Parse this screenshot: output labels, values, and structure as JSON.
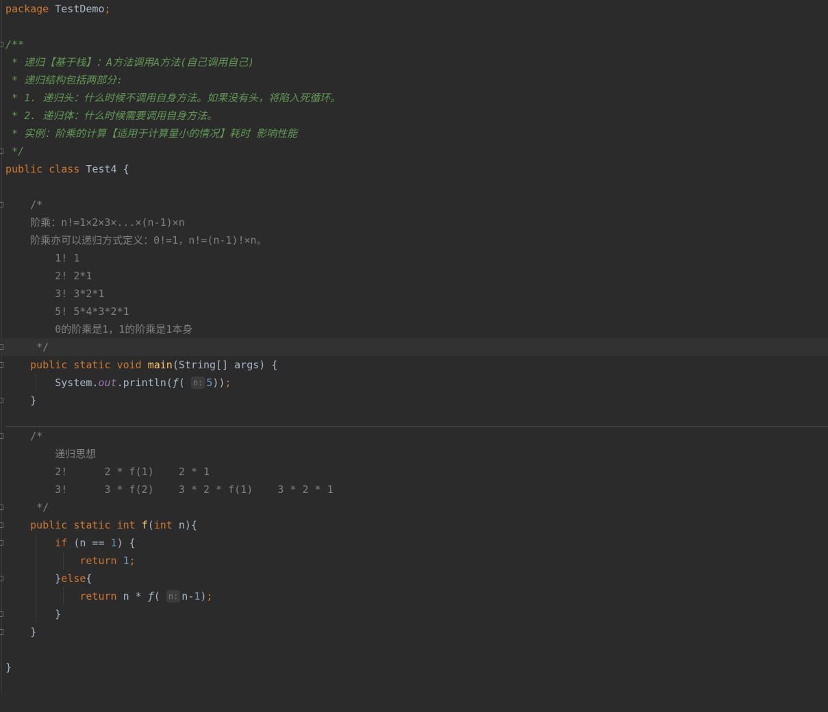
{
  "code": {
    "package_kw": "package",
    "package_name": "TestDemo",
    "semicolon": ";",
    "doc": {
      "open": "/**",
      "line1": " * 递归【基于栈】：A方法调用A方法(自己调用自己)",
      "line2": " * 递归结构包括两部分:",
      "line3": " * 1. 递归头：什么时候不调用自身方法。如果没有头，将陷入死循环。",
      "line4": " * 2. 递归体：什么时候需要调用自身方法。",
      "line5": " * 实例：阶乘的计算【适用于计算量小的情况】耗时 影响性能",
      "close": " */"
    },
    "class_decl": {
      "public": "public",
      "class": "class",
      "name": "Test4",
      "brace": " {"
    },
    "comment1": {
      "open": "    /*",
      "l1": "    阶乘：n!=1×2×3×...×(n-1)×n",
      "l2": "    阶乘亦可以递归方式定义：0!=1，n!=(n-1)!×n。",
      "l3": "        1! 1",
      "l4": "        2! 2*1",
      "l5": "        3! 3*2*1",
      "l6": "        5! 5*4*3*2*1",
      "l7": "        0的阶乘是1，1的阶乘是1本身",
      "close": "     */"
    },
    "main": {
      "public": "public",
      "static": "static",
      "void": "void",
      "name": "main",
      "params": "(String[] args) {",
      "system": "System.",
      "out": "out",
      "println": ".println(",
      "f": "ƒ",
      "paren": "(",
      "hint": "n:",
      "arg": "5",
      "close_call": "))",
      "semi": ";",
      "close": "}"
    },
    "comment2": {
      "open": "    /*",
      "l1": "        递归思想",
      "l2": "        2!      2 * f(1)    2 * 1",
      "l3": "        3!      3 * f(2)    3 * 2 * f(1)    3 * 2 * 1",
      "close": "     */"
    },
    "f_method": {
      "public": "public",
      "static": "static",
      "int": "int",
      "name": "f",
      "int2": "int",
      "param": " n){",
      "if": "if",
      "cond_a": " (n == ",
      "one": "1",
      "cond_b": ") {",
      "return": "return",
      "one2": "1",
      "semi": ";",
      "else_open": "}",
      "else": "else",
      "else_brace": "{",
      "return2": "return",
      "expr": " n * ",
      "f": "ƒ",
      "paren": "(",
      "hint": "n:",
      "arg": "n-",
      "arg_num": "1",
      "close_call": ")",
      "semi2": ";",
      "inner_close": "}",
      "close": "}"
    },
    "class_close": "}"
  }
}
